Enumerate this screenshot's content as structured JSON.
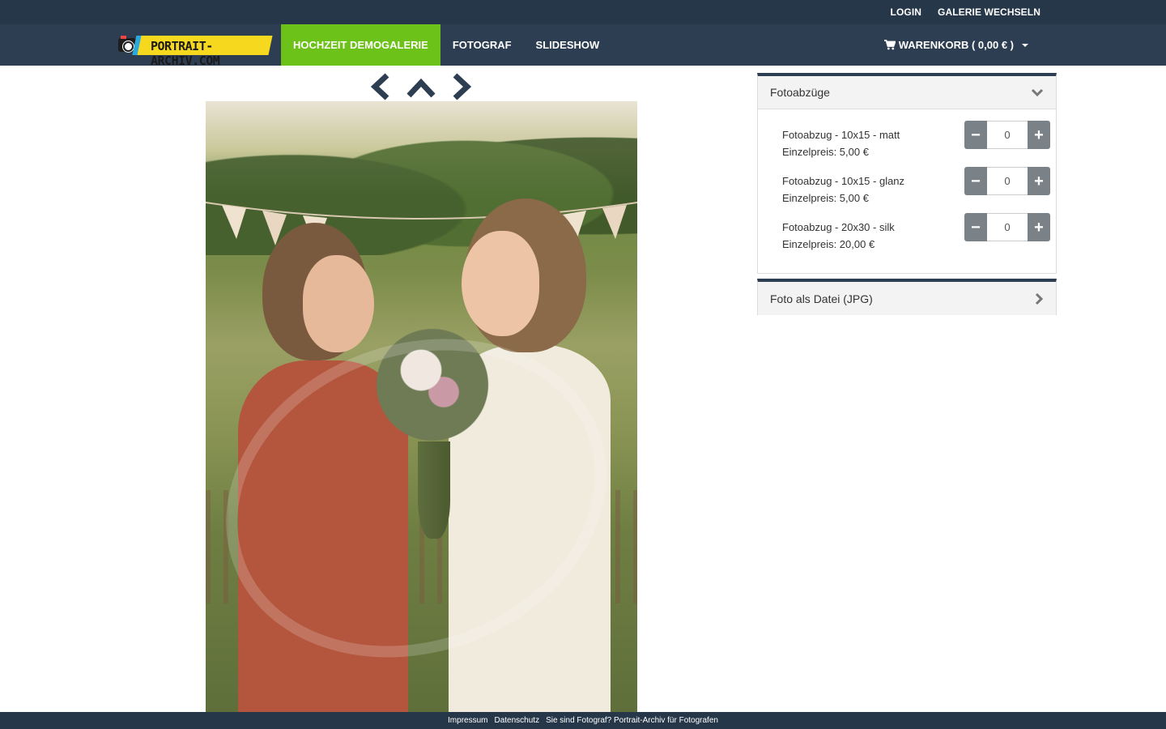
{
  "topbar": {
    "login": "LOGIN",
    "switch_gallery": "GALERIE WECHSELN"
  },
  "logo": {
    "text": "PORTRAIT-ARCHIV.COM"
  },
  "nav": {
    "items": [
      {
        "label": "HOCHZEIT DEMOGALERIE",
        "active": true
      },
      {
        "label": "FOTOGRAF",
        "active": false
      },
      {
        "label": "SLIDESHOW",
        "active": false
      }
    ]
  },
  "cart": {
    "label": "WARENKORB ( 0,00 € )"
  },
  "photo_nav": {
    "prev": "chevron-left-icon",
    "up": "chevron-up-icon",
    "next": "chevron-right-icon"
  },
  "panels": {
    "prints": {
      "title": "Fotoabzüge",
      "items": [
        {
          "name": "Fotoabzug - 10x15 - matt",
          "price": "Einzelpreis: 5,00 €",
          "qty": "0"
        },
        {
          "name": "Fotoabzug - 10x15 - glanz",
          "price": "Einzelpreis: 5,00 €",
          "qty": "0"
        },
        {
          "name": "Fotoabzug - 20x30 - silk",
          "price": "Einzelpreis: 20,00 €",
          "qty": "0"
        }
      ]
    },
    "file": {
      "title": "Foto als Datei (JPG)"
    }
  },
  "stepper": {
    "minus": "−",
    "plus": "+"
  },
  "footer": {
    "impressum": "Impressum",
    "datenschutz": "Datenschutz",
    "photographer": "Sie sind Fotograf? Portrait-Archiv für Fotografen"
  },
  "colors": {
    "topbar": "#26374a",
    "navbar": "#2d3e52",
    "active_nav": "#6cc219",
    "stepper_btn": "#7a8288"
  }
}
